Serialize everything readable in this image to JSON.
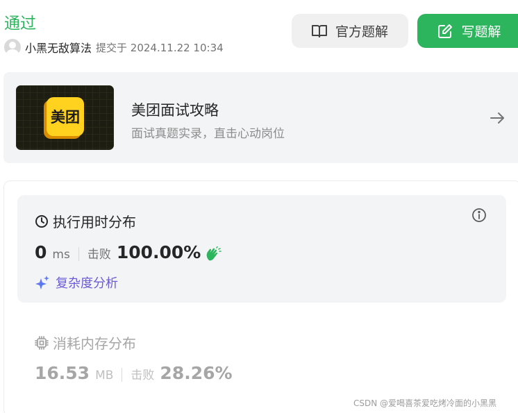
{
  "submission": {
    "status": "通过",
    "author": "小黑无敌算法",
    "submitted_text": "提交于 2024.11.22 10:34"
  },
  "buttons": {
    "official_solution": "官方题解",
    "write_solution": "写题解"
  },
  "banner": {
    "logo_text": "美团",
    "title": "美团面试攻略",
    "subtitle": "面试真题实录，直击心动岗位"
  },
  "runtime": {
    "heading": "执行用时分布",
    "value": "0",
    "unit": "ms",
    "beat_label": "击败",
    "beat_value": "100.00%",
    "complexity_label": "复杂度分析"
  },
  "memory": {
    "heading": "消耗内存分布",
    "value": "16.53",
    "unit": "MB",
    "beat_label": "击败",
    "beat_value": "28.26%"
  },
  "watermark": "CSDN @爱喝喜茶爱吃烤冷面的小黑黑",
  "colors": {
    "accent_green": "#2db55d",
    "complexity_purple": "#6b5bd6",
    "logo_yellow": "#ffd21f"
  },
  "icons": {
    "official": "book-open-icon",
    "write": "edit-icon",
    "banner_arrow": "arrow-right-icon",
    "runtime": "clock-icon",
    "info": "info-icon",
    "beat": "clap-icon",
    "complexity": "sparkle-icon",
    "memory": "chip-icon"
  }
}
